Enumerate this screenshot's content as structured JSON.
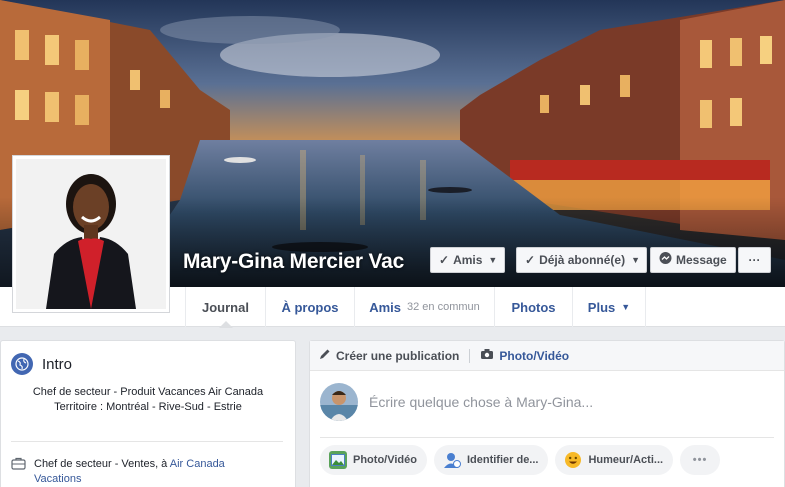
{
  "profile": {
    "name": "Mary-Gina Mercier Vac"
  },
  "cover_buttons": {
    "friends": "Amis",
    "following": "Déjà abonné(e)",
    "message": "Message",
    "more": "···"
  },
  "nav": {
    "timeline": "Journal",
    "about": "À propos",
    "friends": "Amis",
    "friends_common": "32 en commun",
    "photos": "Photos",
    "more": "Plus"
  },
  "intro": {
    "title": "Intro",
    "bio_line1": "Chef de secteur - Produit Vacances Air Canada",
    "bio_line2": "Territoire : Montréal - Rive-Sud - Estrie",
    "work_prefix": "Chef de secteur - Ventes, à",
    "work_company_a": "Air Canada",
    "work_company_b": "Vacations"
  },
  "composer": {
    "tab_create": "Créer une publication",
    "tab_photo": "Photo/Vidéo",
    "placeholder": "Écrire quelque chose à Mary-Gina...",
    "action_photo": "Photo/Vidéo",
    "action_tag": "Identifier de...",
    "action_mood": "Humeur/Acti...",
    "action_more": "•••"
  },
  "colors": {
    "link": "#365899",
    "brand": "#4267b2",
    "page_bg": "#e9ebee"
  }
}
